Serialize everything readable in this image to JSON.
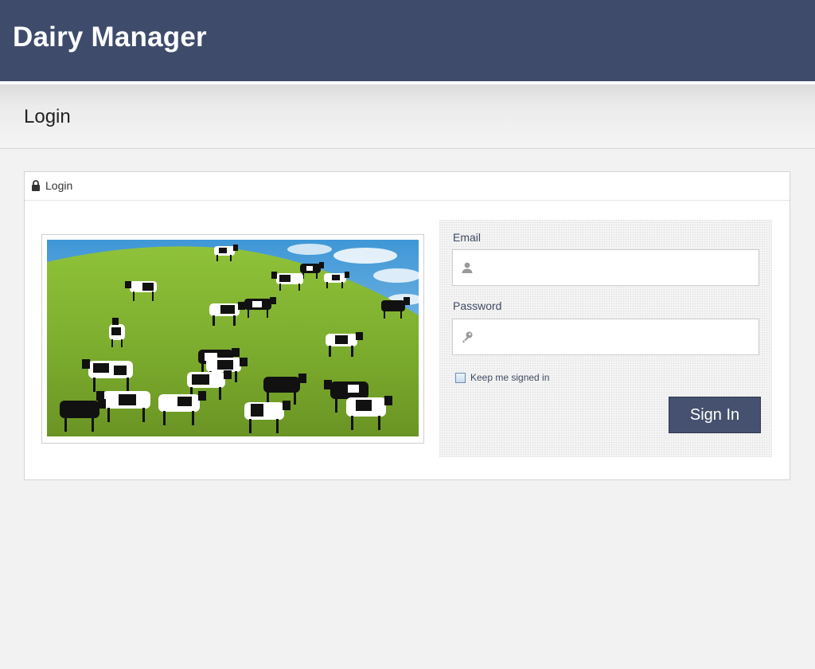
{
  "header": {
    "app_title": "Dairy Manager"
  },
  "subheader": {
    "page_title": "Login"
  },
  "panel": {
    "heading": "Login",
    "heading_icon": "lock-icon",
    "image": {
      "subject": "cows-on-hill-photo"
    }
  },
  "form": {
    "email": {
      "label": "Email",
      "value": "",
      "placeholder": "",
      "icon": "user-icon"
    },
    "password": {
      "label": "Password",
      "value": "",
      "placeholder": "",
      "icon": "key-icon"
    },
    "remember": {
      "label": "Keep me signed in",
      "checked": false
    },
    "submit_label": "Sign In"
  },
  "colors": {
    "header_bg": "#3f4b6b",
    "button_bg": "#45516f",
    "label_text": "#3e4a63",
    "page_bg": "#f2f2f2"
  }
}
